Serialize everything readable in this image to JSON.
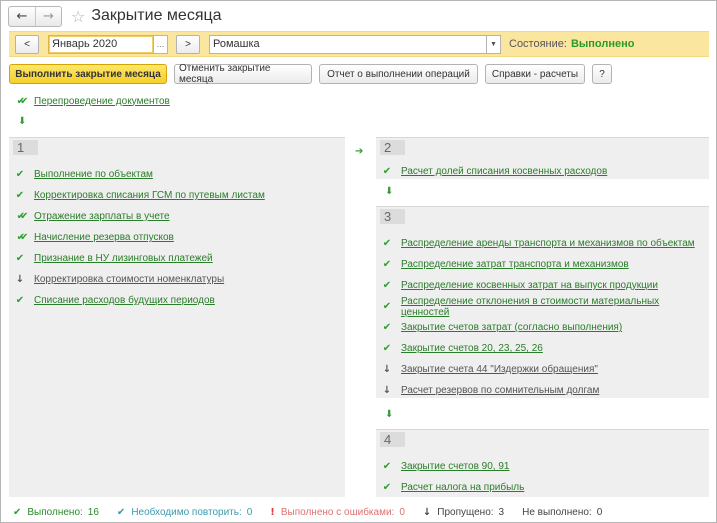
{
  "window": {
    "title": "Закрытие месяца",
    "back_icon": "arrow-left-icon",
    "forward_icon": "arrow-right-icon",
    "favorite_icon": "star-icon"
  },
  "period": {
    "prev_label": "<",
    "next_label": ">",
    "value": "Январь 2020",
    "ellipsis": "...",
    "organization": "Ромашка",
    "state_label": "Состояние:",
    "state_value": "Выполнено"
  },
  "toolbar": {
    "run": "Выполнить закрытие месяца",
    "cancel": "Отменить закрытие месяца",
    "report": "Отчет о выполнении операций",
    "help": "Справки - расчеты",
    "question": "?"
  },
  "top_item": {
    "label": "Перепроведение документов",
    "status": "done_multi"
  },
  "groups": [
    {
      "number": "1",
      "items": [
        {
          "label": "Выполнение по объектам",
          "status": "done"
        },
        {
          "label": "Корректировка списания ГСМ по путевым листам",
          "status": "done"
        },
        {
          "label": "Отражение зарплаты в учете",
          "status": "done_multi"
        },
        {
          "label": "Начисление резерва отпусков",
          "status": "done_multi"
        },
        {
          "label": "Признание в НУ лизинговых платежей",
          "status": "done"
        },
        {
          "label": "Корректировка стоимости номенклатуры",
          "status": "skipped"
        },
        {
          "label": "Списание расходов будущих периодов",
          "status": "done"
        }
      ]
    },
    {
      "number": "2",
      "items": [
        {
          "label": "Расчет долей списания косвенных расходов",
          "status": "done"
        }
      ]
    },
    {
      "number": "3",
      "items": [
        {
          "label": "Распределение аренды транспорта и механизмов по объектам",
          "status": "done"
        },
        {
          "label": "Распределение затрат транспорта и механизмов",
          "status": "done"
        },
        {
          "label": "Распределение косвенных затрат на выпуск продукции",
          "status": "done"
        },
        {
          "label": "Распределение отклонения в стоимости материальных ценностей",
          "status": "done"
        },
        {
          "label": "Закрытие счетов затрат (согласно выполнения)",
          "status": "done"
        },
        {
          "label": "Закрытие счетов 20, 23, 25, 26",
          "status": "done"
        },
        {
          "label": "Закрытие счета 44 \"Издержки обращения\"",
          "status": "skipped"
        },
        {
          "label": "Расчет резервов по сомнительным долгам",
          "status": "skipped"
        }
      ]
    },
    {
      "number": "4",
      "items": [
        {
          "label": "Закрытие счетов 90, 91",
          "status": "done"
        },
        {
          "label": "Расчет налога на прибыль",
          "status": "done"
        }
      ]
    }
  ],
  "status_bar": {
    "done": {
      "label": "Выполнено:",
      "count": "16",
      "color": "#2a8a2a"
    },
    "repeat": {
      "label": "Необходимо повторить:",
      "count": "0",
      "color": "#3a9ab0"
    },
    "errors": {
      "label": "Выполнено с ошибками:",
      "count": "0",
      "color": "#e07070"
    },
    "skipped": {
      "label": "Пропущено:",
      "count": "3",
      "color": "#444444"
    },
    "not_done": {
      "label": "Не выполнено:",
      "count": "0",
      "color": "#444444"
    }
  },
  "colors": {
    "accent": "#f5cf2a",
    "period_bg": "#fbe6a0",
    "link": "#2a7d2a",
    "state_ok": "#2a9a2a",
    "panel_bg": "#efefef"
  }
}
